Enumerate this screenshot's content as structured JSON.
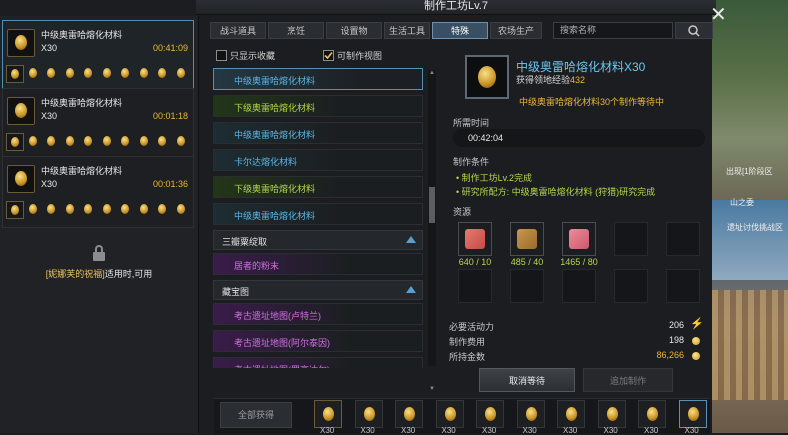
{
  "window": {
    "title": "制作工坊Lv.7"
  },
  "queue": {
    "items": [
      {
        "name": "中级奥雷哈熔化材料",
        "count": "X30",
        "time": "00:41:09",
        "steps": 10
      },
      {
        "name": "中级奥雷哈熔化材料",
        "count": "X30",
        "time": "00:01:18",
        "steps": 10
      },
      {
        "name": "中级奥雷哈熔化材料",
        "count": "X30",
        "time": "00:01:36",
        "steps": 10
      }
    ],
    "locked": {
      "prefix": "[妮娜芙的祝福]",
      "suffix": "适用时,可用"
    }
  },
  "tabs": [
    {
      "label": "战斗道具",
      "active": false
    },
    {
      "label": "烹饪",
      "active": false
    },
    {
      "label": "设置物",
      "active": false
    },
    {
      "label": "生活工具",
      "active": false
    },
    {
      "label": "特殊",
      "active": true
    },
    {
      "label": "农场生产",
      "active": false
    }
  ],
  "search": {
    "placeholder": "搜索名称"
  },
  "filters": {
    "favorites_only": "只显示收藏",
    "craftable_view": "可制作视图",
    "favorites_checked": false,
    "craftable_checked": true
  },
  "recipe_list": [
    {
      "type": "row",
      "label": "中级奥雷哈熔化材料",
      "color": "blue",
      "selected": true
    },
    {
      "type": "row",
      "label": "下级奥雷哈熔化材料",
      "color": "green"
    },
    {
      "type": "row",
      "label": "中级奥雷哈熔化材料",
      "color": "blue"
    },
    {
      "type": "row",
      "label": "卡尔达熔化材料",
      "color": "blue"
    },
    {
      "type": "row",
      "label": "下级奥雷哈熔化材料",
      "color": "green"
    },
    {
      "type": "row",
      "label": "中级奥雷哈熔化材料",
      "color": "blue"
    },
    {
      "type": "cat",
      "label": "三瓣粟绽取"
    },
    {
      "type": "row",
      "label": "居者的粉末",
      "color": "purple"
    },
    {
      "type": "cat",
      "label": "藏宝图"
    },
    {
      "type": "row",
      "label": "考古遗址地图(卢特兰)",
      "color": "purple"
    },
    {
      "type": "row",
      "label": "考古遗址地图(阿尔泰因)",
      "color": "purple"
    },
    {
      "type": "row",
      "label": "考古遗址地图(罗亨达尔)",
      "color": "purple"
    }
  ],
  "detail": {
    "title": "中级奥雷哈熔化材料X30",
    "exp_label": "获得领地经验",
    "exp_value": "432",
    "waiting": "中级奥雷哈熔化材料30个制作等待中",
    "time_label": "所需时间",
    "time_value": "00:42:04",
    "cond_label": "制作条件",
    "conditions": [
      "• 制作工坊Lv.2完成",
      "• 研究所配方: 中级奥雷哈熔化材料 (狩猎)研究完成"
    ],
    "resources_label": "资源",
    "resources": [
      {
        "name": "meat-icon",
        "count": "640 / 10"
      },
      {
        "name": "wood-icon",
        "count": "485 / 40"
      },
      {
        "name": "fish-icon",
        "count": "1465 / 80"
      }
    ],
    "vitality_label": "必要活动力",
    "vitality_value": "206",
    "fee_label": "制作费用",
    "fee_value": "198",
    "gold_label": "所持金数",
    "gold_value": "86,266",
    "cancel_button": "取消等待",
    "add_button": "追加制作"
  },
  "bottom": {
    "collect_all": "全部获得",
    "slot_label": "X30",
    "slots": 10
  },
  "game_overlay": {
    "text1": "出现[1阶段区",
    "text2": "山之委",
    "text3": "遗址讨伐挑战区"
  },
  "colors": {
    "accent": "#5ab8e8",
    "gold": "#e8b838",
    "green": "#b6d84a",
    "purple": "#d070e0"
  }
}
